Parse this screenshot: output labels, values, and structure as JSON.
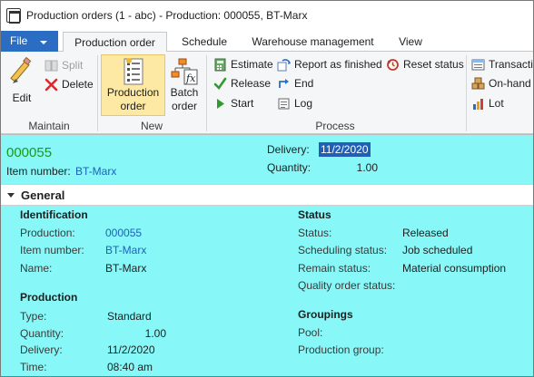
{
  "window": {
    "title": "Production orders (1 - abc) - Production: 000055, BT-Marx"
  },
  "tabs": {
    "file": "File",
    "items": [
      "Production order",
      "Schedule",
      "Warehouse management",
      "View"
    ]
  },
  "ribbon": {
    "maintain": {
      "label": "Maintain",
      "edit": "Edit",
      "split": "Split",
      "delete": "Delete"
    },
    "new": {
      "label": "New",
      "production_order_line1": "Production",
      "production_order_line2": "order",
      "batch_order_line1": "Batch",
      "batch_order_line2": "order"
    },
    "process": {
      "label": "Process",
      "estimate": "Estimate",
      "release": "Release",
      "start": "Start",
      "report_as_finished": "Report as finished",
      "end": "End",
      "log": "Log",
      "reset_status": "Reset status"
    },
    "extra": {
      "transactions": "Transactio",
      "on_hand": "On-hand",
      "lot": "Lot"
    }
  },
  "header": {
    "production_id": "000055",
    "item_number_label": "Item number:",
    "item_number": "BT-Marx",
    "delivery_label": "Delivery:",
    "delivery": "11/2/2020",
    "quantity_label": "Quantity:",
    "quantity": "1.00"
  },
  "general": {
    "title": "General",
    "identification": {
      "title": "Identification",
      "production_label": "Production:",
      "production": "000055",
      "item_number_label": "Item number:",
      "item_number": "BT-Marx",
      "name_label": "Name:",
      "name": "BT-Marx"
    },
    "production": {
      "title": "Production",
      "type_label": "Type:",
      "type": "Standard",
      "quantity_label": "Quantity:",
      "quantity": "1.00",
      "delivery_label": "Delivery:",
      "delivery": "11/2/2020",
      "time_label": "Time:",
      "time": "08:40 am"
    },
    "status": {
      "title": "Status",
      "status_label": "Status:",
      "status": "Released",
      "scheduling_label": "Scheduling status:",
      "scheduling": "Job scheduled",
      "remain_label": "Remain status:",
      "remain": "Material consumption",
      "quality_label": "Quality order status:"
    },
    "groupings": {
      "title": "Groupings",
      "pool_label": "Pool:",
      "production_group_label": "Production group:"
    }
  },
  "colors": {
    "accent": "#2b6dc2",
    "form_background": "#87f7f7",
    "id_green": "#1a9a1a",
    "link": "#1a63b8",
    "selection": "#1f5fb6"
  }
}
